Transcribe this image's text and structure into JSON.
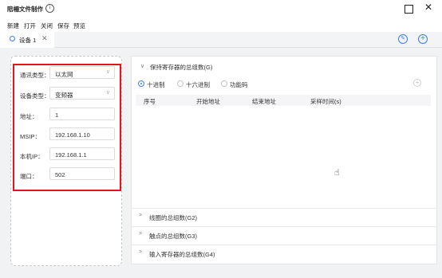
{
  "window": {
    "title": "陪柵文件制作",
    "info_icon": "ⓘ",
    "maximize_icon": "square",
    "close_icon": "✕"
  },
  "menu": [
    "新建",
    "打开",
    "关闭",
    "保存",
    "预览"
  ],
  "tab": {
    "label": "设备 1",
    "close": "✕",
    "icon": "gear-icon"
  },
  "toolbar": {
    "edit_icon": "edit-icon",
    "add_icon": "add-icon"
  },
  "form": {
    "fields": [
      {
        "label": "通讯类型：",
        "value": "以太网",
        "type": "select"
      },
      {
        "label": "设备类型：",
        "value": "变频器",
        "type": "select"
      },
      {
        "label": "地址：",
        "value": "1",
        "type": "text"
      },
      {
        "label": "MSIP：",
        "value": "192.168.1.10",
        "type": "text"
      },
      {
        "label": "本机IP：",
        "value": "192.168.1.1",
        "type": "text"
      },
      {
        "label": "端口：",
        "value": "502",
        "type": "text"
      }
    ],
    "highlight_color": "#e5131b"
  },
  "sections": {
    "expanded": "保持寄存器的总组数(G)",
    "radios": [
      {
        "label": "十进制",
        "checked": true
      },
      {
        "label": "十六进制",
        "checked": false
      },
      {
        "label": "功能码",
        "checked": false
      }
    ],
    "table_headers": [
      "序号",
      "开始地址",
      "结束地址",
      "采样时间(s)"
    ],
    "collapsed": [
      "线圈的总组数(G2)",
      "触点的总组数(G3)",
      "输入寄存器的总组数(G4)"
    ]
  },
  "colors": {
    "accent": "#3b7df0",
    "panel_bg": "#f1f2f4"
  }
}
